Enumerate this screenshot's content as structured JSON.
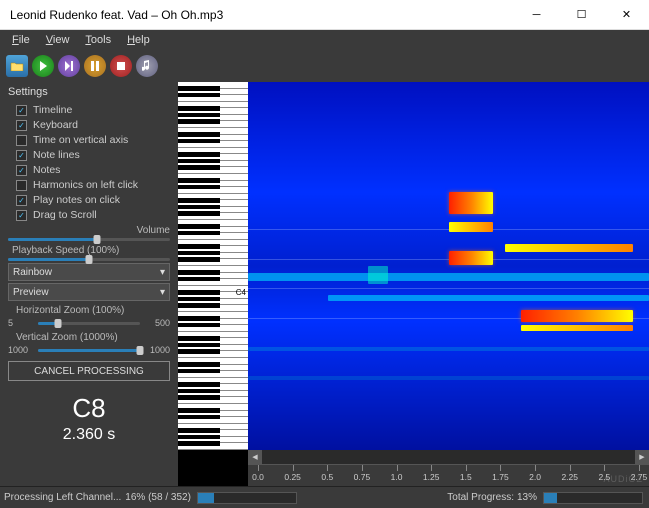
{
  "window": {
    "title": "Leonid Rudenko feat. Vad – Oh Oh.mp3"
  },
  "menu": {
    "file": "File",
    "view": "View",
    "tools": "Tools",
    "help": "Help"
  },
  "settings": {
    "title": "Settings",
    "items": [
      {
        "label": "Timeline",
        "checked": true
      },
      {
        "label": "Keyboard",
        "checked": true
      },
      {
        "label": "Time on vertical axis",
        "checked": false
      },
      {
        "label": "Note lines",
        "checked": true
      },
      {
        "label": "Notes",
        "checked": true
      },
      {
        "label": "Harmonics on left click",
        "checked": false
      },
      {
        "label": "Play notes on click",
        "checked": true
      },
      {
        "label": "Drag to Scroll",
        "checked": true
      }
    ],
    "volume_label": "Volume",
    "playback_label": "Playback Speed (100%)",
    "colormap": {
      "value": "Rainbow"
    },
    "preview": {
      "value": "Preview"
    },
    "hzoom_label": "Horizontal Zoom (100%)",
    "hzoom_min": "5",
    "hzoom_max": "500",
    "vzoom_label": "Vertical Zoom (1000%)",
    "vzoom_min": "1000",
    "vzoom_max": "1000",
    "cancel": "CANCEL PROCESSING",
    "note": "C8",
    "time": "2.360 s"
  },
  "ruler": {
    "ticks": [
      "0.0",
      "0.25",
      "0.5",
      "0.75",
      "1.0",
      "1.25",
      "1.5",
      "1.75",
      "2.0",
      "2.25",
      "2.5",
      "2.75"
    ]
  },
  "piano": {
    "c4_label": "C4"
  },
  "status": {
    "left_text": "Processing Left Channel...",
    "left_pct": "16% (58 / 352)",
    "total_label": "Total Progress:",
    "total_pct": "13%"
  },
  "watermark": "AUDiOZ"
}
